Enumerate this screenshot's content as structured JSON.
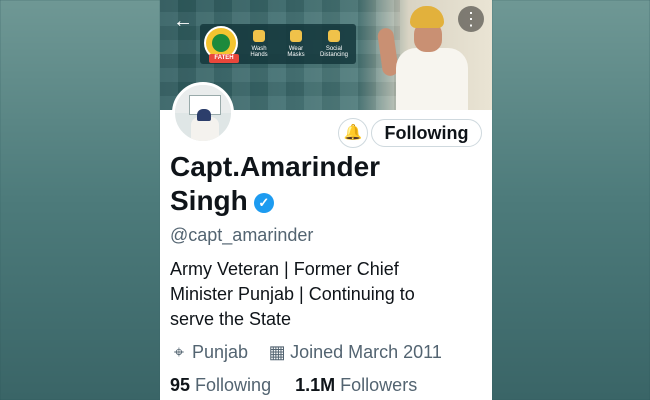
{
  "banner": {
    "campaign_logo": "FATEH",
    "items": [
      "Wash Hands",
      "Wear Masks",
      "Social Distancing"
    ]
  },
  "header": {
    "back_icon": "arrow-left-icon",
    "more_icon": "more-vertical-icon"
  },
  "profile": {
    "display_name_line1": "Capt.Amarinder",
    "display_name_line2": "Singh",
    "verified_icon": "verified-badge-icon",
    "handle": "@capt_amarinder",
    "bio_lines": [
      "Army Veteran | Former Chief",
      "Minister Punjab | Continuing to",
      "serve the State"
    ],
    "location": "Punjab",
    "location_icon": "location-pin-icon",
    "joined": "Joined March 2011",
    "joined_icon": "calendar-icon",
    "following_count": "95",
    "following_label": "Following",
    "followers_count": "1.1M",
    "followers_label": "Followers"
  },
  "actions": {
    "notify_icon": "bell-plus-icon",
    "follow_button_label": "Following"
  },
  "colors": {
    "accent": "#1d9bf0",
    "text_primary": "#0f1419",
    "text_secondary": "#536471"
  }
}
